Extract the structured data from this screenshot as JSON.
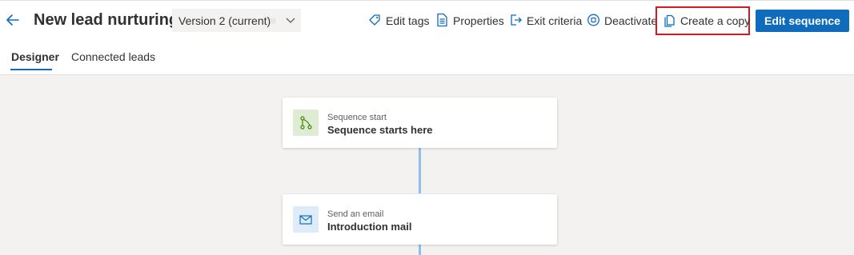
{
  "header": {
    "title": "New lead nurturing",
    "version": "Version 2 (current)",
    "actions": [
      {
        "label": "Edit tags",
        "icon": "tag-icon"
      },
      {
        "label": "Properties",
        "icon": "document-icon"
      },
      {
        "label": "Exit criteria",
        "icon": "exit-icon"
      },
      {
        "label": "Deactivate",
        "icon": "stop-circle-icon"
      },
      {
        "label": "Create a copy",
        "icon": "copy-icon"
      }
    ],
    "primary_label": "Edit sequence"
  },
  "tabs": [
    {
      "label": "Designer",
      "active": true
    },
    {
      "label": "Connected leads",
      "active": false
    }
  ],
  "steps": [
    {
      "type": "Sequence start",
      "title": "Sequence starts here",
      "icon": "branch-icon",
      "icon_bg": "#dfecd4"
    },
    {
      "type": "Send an email",
      "title": "Introduction mail",
      "icon": "mail-icon",
      "icon_bg": "#deecf9"
    }
  ],
  "colors": {
    "primary": "#0f6cbd",
    "highlight_border": "#d21a22",
    "connector": "#8cc0ea",
    "canvas_bg": "#f3f2f1"
  }
}
